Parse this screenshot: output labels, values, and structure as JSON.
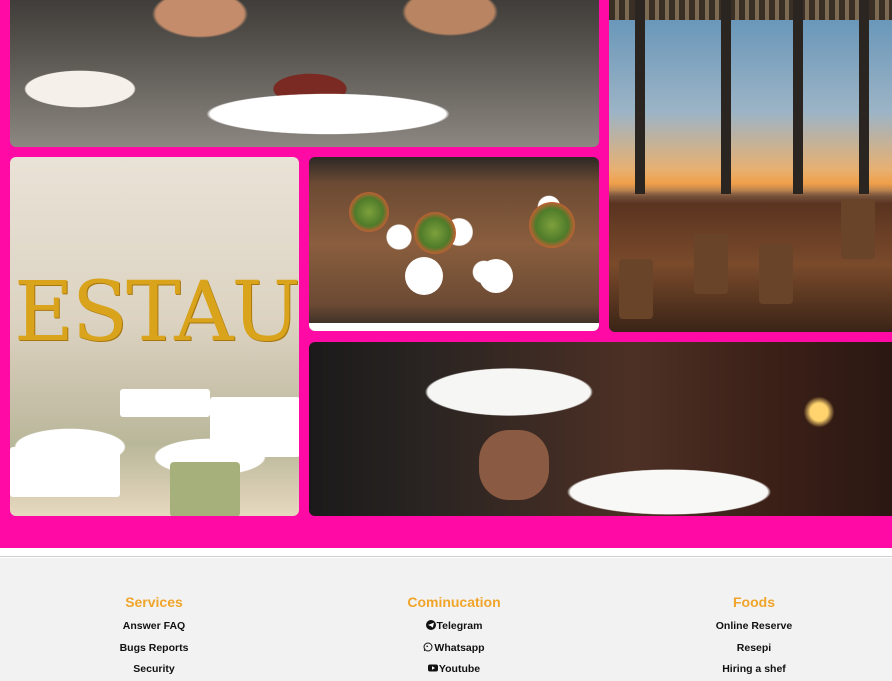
{
  "gallery": {
    "images": [
      {
        "alt": "plated gourmet dish"
      },
      {
        "alt": "restaurant at sunset"
      },
      {
        "alt": "restaurant sign"
      },
      {
        "alt": "overhead shared table"
      },
      {
        "alt": "waiter serving plates"
      }
    ],
    "sign_text": "ESTAUR",
    "background_color": "#ff0aa5"
  },
  "footer": {
    "heading_color": "#f0a52a",
    "columns": [
      {
        "title": "Services",
        "links": [
          "Answer FAQ",
          "Bugs Reports",
          "Security"
        ]
      },
      {
        "title": "Cominucation",
        "links": [
          {
            "icon": "telegram-icon",
            "label": "Telegram"
          },
          {
            "icon": "whatsapp-icon",
            "label": "Whatsapp"
          },
          {
            "icon": "youtube-icon",
            "label": "Youtube"
          }
        ]
      },
      {
        "title": "Foods",
        "links": [
          "Online Reserve",
          "Resepi",
          "Hiring a shef"
        ]
      }
    ]
  }
}
